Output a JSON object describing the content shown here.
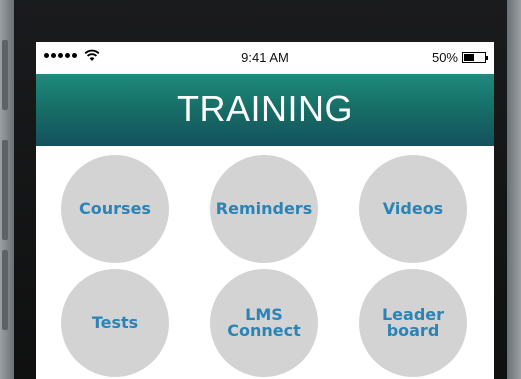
{
  "statusbar": {
    "signal_icon": "signal-dots-icon",
    "wifi_icon": "wifi-icon",
    "time": "9:41 AM",
    "battery_percent": "50%",
    "battery_level": 0.5
  },
  "header": {
    "title": "TRAINING"
  },
  "tiles": [
    {
      "label": "Courses"
    },
    {
      "label": "Reminders"
    },
    {
      "label": "Videos"
    },
    {
      "label": "Tests"
    },
    {
      "label": "LMS\nConnect"
    },
    {
      "label": "Leader\nboard"
    }
  ],
  "colors": {
    "header_top": "#1f8a7d",
    "header_bottom": "#14505e",
    "tile_bg": "#d3d3d3",
    "tile_text": "#2c83b6"
  }
}
